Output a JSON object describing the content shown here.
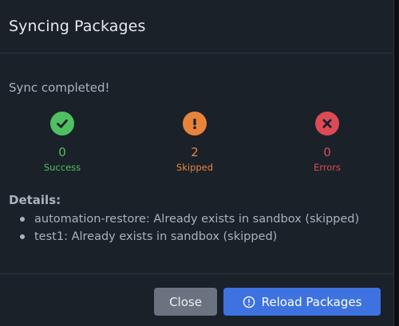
{
  "dialog": {
    "title": "Syncing Packages",
    "status": "Sync completed!"
  },
  "stats": {
    "success": {
      "count": "0",
      "label": "Success",
      "icon": "check-circle-icon",
      "color": "#4ec062"
    },
    "skipped": {
      "count": "2",
      "label": "Skipped",
      "icon": "exclamation-circle-icon",
      "color": "#e8843a"
    },
    "errors": {
      "count": "0",
      "label": "Errors",
      "icon": "x-circle-icon",
      "color": "#dc4a56"
    }
  },
  "details": {
    "heading": "Details:",
    "items": [
      "automation-restore: Already exists in sandbox (skipped)",
      "test1: Already exists in sandbox (skipped)"
    ]
  },
  "footer": {
    "close_label": "Close",
    "reload_label": "Reload Packages",
    "reload_icon": "info-circle-icon"
  }
}
